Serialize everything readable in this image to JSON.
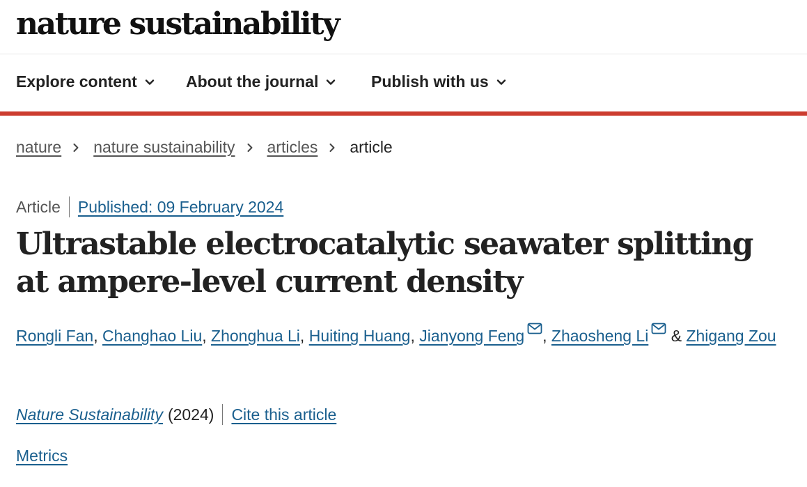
{
  "header": {
    "logo_text": "nature sustainability"
  },
  "nav": {
    "items": [
      {
        "label": "Explore content",
        "icon": "chevron-down-icon"
      },
      {
        "label": "About the journal",
        "icon": "chevron-down-icon"
      },
      {
        "label": "Publish with us",
        "icon": "chevron-down-icon"
      }
    ],
    "accent_color": "#cc3c2f"
  },
  "breadcrumb": {
    "items": [
      "nature",
      "nature sustainability",
      "articles"
    ],
    "current": "article"
  },
  "article": {
    "type": "Article",
    "published": "Published: 09 February 2024",
    "title": "Ultrastable electrocatalytic seawater splitting at ampere-level current density",
    "authors": [
      {
        "name": "Rongli Fan",
        "sep": ", "
      },
      {
        "name": "Changhao Liu",
        "sep": ", "
      },
      {
        "name": "Zhonghua Li",
        "sep": ", "
      },
      {
        "name": "Huiting Huang",
        "sep": ", "
      },
      {
        "name": "Jianyong Feng",
        "sep": ", "
      },
      {
        "name": "Zhaosheng Li",
        "sep": " & "
      },
      {
        "name": "Zhigang Zou",
        "sep": ""
      }
    ],
    "journal": "Nature Sustainability",
    "year": "(2024)",
    "cite": "Cite this article",
    "metrics": "Metrics",
    "link_color": "#1a5f8e"
  }
}
